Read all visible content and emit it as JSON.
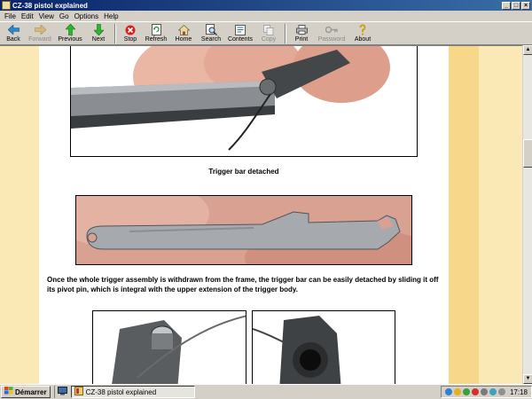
{
  "window": {
    "title": "CZ-38 pistol explained"
  },
  "menu": [
    "File",
    "Edit",
    "View",
    "Go",
    "Options",
    "Help"
  ],
  "toolbar": {
    "back": "Back",
    "forward": "Forward",
    "previous": "Previous",
    "next": "Next",
    "stop": "Stop",
    "refresh": "Refresh",
    "home": "Home",
    "search": "Search",
    "contents": "Contents",
    "copy": "Copy",
    "print": "Print",
    "password": "Password",
    "about": "About"
  },
  "content": {
    "caption1": "Trigger bar detached",
    "paragraph": "Once the whole trigger assembly is withdrawn from the frame, the trigger bar can be easily detached by sliding it off its pivot pin, which is integral with the upper extension of the trigger body."
  },
  "taskbar": {
    "start": "Démarrer",
    "task": "CZ-38 pistol explained",
    "clock": "17:18"
  },
  "colors": {
    "page_bg": "#ffffff",
    "side_bg": "#fbe9b5",
    "accent_col": "#f7d88a"
  }
}
